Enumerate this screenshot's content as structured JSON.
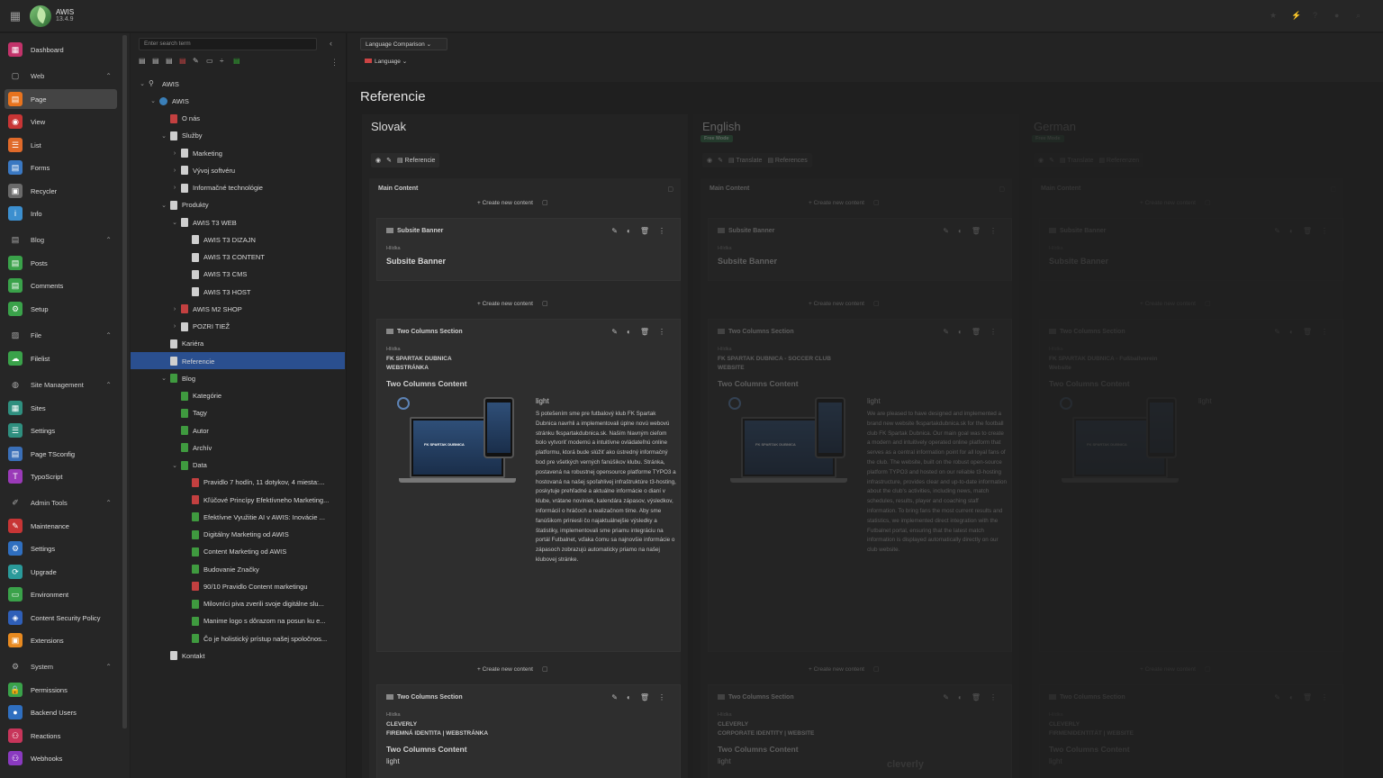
{
  "app": {
    "name": "AWIS",
    "version": "13.4.9"
  },
  "modules": [
    {
      "type": "item",
      "label": "Dashboard",
      "color": "#c2336a",
      "icon": "dashboard-icon",
      "glyph": "▦"
    },
    {
      "type": "header",
      "label": "Web",
      "icon": "web-icon",
      "glyph": "▢"
    },
    {
      "type": "item",
      "label": "Page",
      "color": "#e8731e",
      "icon": "page-icon",
      "glyph": "▤",
      "active": true
    },
    {
      "type": "item",
      "label": "View",
      "color": "#c73535",
      "icon": "view-icon",
      "glyph": "◉"
    },
    {
      "type": "item",
      "label": "List",
      "color": "#e06a2a",
      "icon": "list-icon",
      "glyph": "☰"
    },
    {
      "type": "item",
      "label": "Forms",
      "color": "#3a78c2",
      "icon": "forms-icon",
      "glyph": "▤"
    },
    {
      "type": "item",
      "label": "Recycler",
      "color": "#6a6a6a",
      "icon": "recycler-icon",
      "glyph": "▣"
    },
    {
      "type": "item",
      "label": "Info",
      "color": "#3c8fcf",
      "icon": "info-icon",
      "glyph": "i"
    },
    {
      "type": "header",
      "label": "Blog",
      "icon": "blog-icon",
      "glyph": "▤"
    },
    {
      "type": "item",
      "label": "Posts",
      "color": "#3aa24a",
      "icon": "posts-icon",
      "glyph": "▤"
    },
    {
      "type": "item",
      "label": "Comments",
      "color": "#3aa24a",
      "icon": "comments-icon",
      "glyph": "▤"
    },
    {
      "type": "item",
      "label": "Setup",
      "color": "#3aa24a",
      "icon": "setup-icon",
      "glyph": "⚙"
    },
    {
      "type": "header",
      "label": "File",
      "icon": "file-icon",
      "glyph": "▨"
    },
    {
      "type": "item",
      "label": "Filelist",
      "color": "#3aa24a",
      "icon": "filelist-icon",
      "glyph": "☁"
    },
    {
      "type": "header",
      "label": "Site Management",
      "icon": "site-management-icon",
      "glyph": "◍"
    },
    {
      "type": "item",
      "label": "Sites",
      "color": "#2f8f7f",
      "icon": "sites-icon",
      "glyph": "▦"
    },
    {
      "type": "item",
      "label": "Settings",
      "color": "#2f8f7f",
      "icon": "settings-icon",
      "glyph": "☰"
    },
    {
      "type": "item",
      "label": "Page TSconfig",
      "color": "#3a6fb8",
      "icon": "page-tsconfig-icon",
      "glyph": "▤"
    },
    {
      "type": "item",
      "label": "TypoScript",
      "color": "#9a3ab8",
      "icon": "typoscript-icon",
      "glyph": "T"
    },
    {
      "type": "header",
      "label": "Admin Tools",
      "icon": "admin-tools-icon",
      "glyph": "✐"
    },
    {
      "type": "item",
      "label": "Maintenance",
      "color": "#c73535",
      "icon": "maintenance-icon",
      "glyph": "✎"
    },
    {
      "type": "item",
      "label": "Settings",
      "color": "#2f6fc0",
      "icon": "admin-settings-icon",
      "glyph": "⚙"
    },
    {
      "type": "item",
      "label": "Upgrade",
      "color": "#2a9a9a",
      "icon": "upgrade-icon",
      "glyph": "⟳"
    },
    {
      "type": "item",
      "label": "Environment",
      "color": "#3aa24a",
      "icon": "environment-icon",
      "glyph": "▭"
    },
    {
      "type": "item",
      "label": "Content Security Policy",
      "color": "#2f5fb8",
      "icon": "csp-icon",
      "glyph": "◈"
    },
    {
      "type": "item",
      "label": "Extensions",
      "color": "#e88a20",
      "icon": "extensions-icon",
      "glyph": "▣"
    },
    {
      "type": "header",
      "label": "System",
      "icon": "system-icon",
      "glyph": "⚙"
    },
    {
      "type": "item",
      "label": "Permissions",
      "color": "#3aa24a",
      "icon": "permissions-icon",
      "glyph": "🔒"
    },
    {
      "type": "item",
      "label": "Backend Users",
      "color": "#2f6fc0",
      "icon": "backend-users-icon",
      "glyph": "●"
    },
    {
      "type": "item",
      "label": "Reactions",
      "color": "#c7355a",
      "icon": "reactions-icon",
      "glyph": "⚇"
    },
    {
      "type": "item",
      "label": "Webhooks",
      "color": "#8a3ac0",
      "icon": "webhooks-icon",
      "glyph": "⚇"
    }
  ],
  "tree": {
    "search_placeholder": "Enter search term",
    "nodes": [
      {
        "label": "AWIS",
        "depth": 0,
        "toggle": "⌄",
        "icon": "root"
      },
      {
        "label": "AWIS",
        "depth": 1,
        "toggle": "⌄",
        "icon": "globe"
      },
      {
        "label": "O nás",
        "depth": 2,
        "toggle": "",
        "icon": "red"
      },
      {
        "label": "Služby",
        "depth": 2,
        "toggle": "⌄",
        "icon": "page"
      },
      {
        "label": "Marketing",
        "depth": 3,
        "toggle": "›",
        "icon": "page"
      },
      {
        "label": "Vývoj softvéru",
        "depth": 3,
        "toggle": "›",
        "icon": "page"
      },
      {
        "label": "Informačné technológie",
        "depth": 3,
        "toggle": "›",
        "icon": "page"
      },
      {
        "label": "Produkty",
        "depth": 2,
        "toggle": "⌄",
        "icon": "page"
      },
      {
        "label": "AWIS T3 WEB",
        "depth": 3,
        "toggle": "⌄",
        "icon": "page"
      },
      {
        "label": "AWIS T3 DIZAJN",
        "depth": 4,
        "toggle": "",
        "icon": "page"
      },
      {
        "label": "AWIS T3 CONTENT",
        "depth": 4,
        "toggle": "",
        "icon": "page"
      },
      {
        "label": "AWIS T3 CMS",
        "depth": 4,
        "toggle": "",
        "icon": "page"
      },
      {
        "label": "AWIS T3 HOST",
        "depth": 4,
        "toggle": "",
        "icon": "page"
      },
      {
        "label": "AWIS M2 SHOP",
        "depth": 3,
        "toggle": "›",
        "icon": "red"
      },
      {
        "label": "POZRI TIEŽ",
        "depth": 3,
        "toggle": "›",
        "icon": "page"
      },
      {
        "label": "Kariéra",
        "depth": 2,
        "toggle": "",
        "icon": "page"
      },
      {
        "label": "Referencie",
        "depth": 2,
        "toggle": "",
        "icon": "page",
        "selected": true
      },
      {
        "label": "Blog",
        "depth": 2,
        "toggle": "⌄",
        "icon": "green"
      },
      {
        "label": "Kategórie",
        "depth": 3,
        "toggle": "",
        "icon": "green"
      },
      {
        "label": "Tagy",
        "depth": 3,
        "toggle": "",
        "icon": "green"
      },
      {
        "label": "Autor",
        "depth": 3,
        "toggle": "",
        "icon": "green"
      },
      {
        "label": "Archív",
        "depth": 3,
        "toggle": "",
        "icon": "green"
      },
      {
        "label": "Data",
        "depth": 3,
        "toggle": "⌄",
        "icon": "green"
      },
      {
        "label": "Pravidlo 7 hodín, 11 dotykov, 4 miesta:...",
        "depth": 4,
        "toggle": "",
        "icon": "red"
      },
      {
        "label": "Kľúčové Princípy Efektívneho Marketing...",
        "depth": 4,
        "toggle": "",
        "icon": "red"
      },
      {
        "label": "Efektívne Využitie AI v AWIS: Inovácie ...",
        "depth": 4,
        "toggle": "",
        "icon": "green"
      },
      {
        "label": "Digitálny Marketing od AWIS",
        "depth": 4,
        "toggle": "",
        "icon": "green"
      },
      {
        "label": "Content Marketing od AWIS",
        "depth": 4,
        "toggle": "",
        "icon": "green"
      },
      {
        "label": "Budovanie Značky",
        "depth": 4,
        "toggle": "",
        "icon": "green"
      },
      {
        "label": "90/10 Pravidlo Content marketingu",
        "depth": 4,
        "toggle": "",
        "icon": "red"
      },
      {
        "label": "Milovníci piva zverili svoje digitálne slu...",
        "depth": 4,
        "toggle": "",
        "icon": "green"
      },
      {
        "label": "Manime logo s dôrazom na posun ku e...",
        "depth": 4,
        "toggle": "",
        "icon": "green"
      },
      {
        "label": "Čo je holistický prístup našej spoločnos...",
        "depth": 4,
        "toggle": "",
        "icon": "green"
      },
      {
        "label": "Kontakt",
        "depth": 2,
        "toggle": "",
        "icon": "page"
      }
    ]
  },
  "docheader": {
    "view_select": "Language Comparison",
    "language_select": "Language"
  },
  "page_title": "Referencie",
  "labels": {
    "main_content": "Main Content",
    "create_new": "+ Create new content",
    "translate": "Translate",
    "free_mode": "Free Mode",
    "header_small": "Hlídka",
    "two_col_content": "Two Columns Content",
    "light": "light"
  },
  "columns": [
    {
      "lang": "Slovak",
      "badge": "",
      "page": "Referencie",
      "ce1": {
        "type": "Subsite Banner",
        "title": "Subsite Banner"
      },
      "ce2": {
        "type": "Two Columns Section",
        "sub1": "FK SPARTAK DUBNICA",
        "sub2": "WEBSTRÁNKA",
        "img_caption": "FK SPARTAK DUBNICA",
        "body": "S potešením sme pre futbalový klub FK Spartak Dubnica navrhli a implementovali úplne novú webovú stránku fkspartakdubnica.sk. Naším hlavným cieľom bolo vytvoriť modernú a intuitívne ovládateľnú online platformu, ktorá bude slúžiť ako ústredný informačný bod pre všetkých verných fanúšikov klubu. Stránka, postavená na robustnej opensource platforme TYPO3 a hostovaná na našej spoľahlivej infraštruktúre t3-hosting, poskytuje prehľadné a aktuálne informácie o dianí v klube, vrátane noviniek, kalendára zápasov, výsledkov, informácií o hráčoch a realizačnom tíme. Aby sme fanúšikom priniesli čo najaktuálnejšie výsledky a štatistiky, implementovali sme priamu integráciu na portál Futbalnet, vďaka čomu sa najnovšie informácie o zápasoch zobrazujú automaticky priamo na našej klubovej stránke."
      },
      "ce3": {
        "type": "Two Columns Section",
        "sub1": "CLEVERLY",
        "sub2": "FIREMNÁ IDENTITA | WEBSTRÁNKA"
      }
    },
    {
      "lang": "English",
      "badge": "Free Mode",
      "page": "References",
      "ce1": {
        "type": "Subsite Banner",
        "title": "Subsite Banner"
      },
      "ce2": {
        "type": "Two Columns Section",
        "sub1": "FK SPARTAK DUBNICA - SOCCER CLUB",
        "sub2": "WEBSITE",
        "img_caption": "FK SPARTAK DUBNICA",
        "body": "We are pleased to have designed and implemented a brand new website fkspartakdubnica.sk for the football club FK Spartak Dubnica. Our main goal was to create a modern and intuitively operated online platform that serves as a central information point for all loyal fans of the club. The website, built on the robust open-source platform TYPO3 and hosted on our reliable t3-hosting infrastructure, provides clear and up-to-date information about the club's activities, including news, match schedules, results, player and coaching staff information. To bring fans the most current results and statistics, we implemented direct integration with the Futbalnet portal, ensuring that the latest match information is displayed automatically directly on our club website."
      },
      "ce3": {
        "type": "Two Columns Section",
        "sub1": "CLEVERLY",
        "sub2": "CORPORATE IDENTITY | WEBSITE",
        "extra": "cleverly"
      }
    },
    {
      "lang": "German",
      "badge": "Free Mode",
      "page": "Referenzen",
      "ce1": {
        "type": "Subsite Banner",
        "title": "Subsite Banner"
      },
      "ce2": {
        "type": "Two Columns Section",
        "sub1": "FK SPARTAK DUBNICA - Fußballverein",
        "sub2": "Website",
        "img_caption": "FK SPARTAK DUBNICA",
        "body": ""
      },
      "ce3": {
        "type": "Two Columns Section",
        "sub1": "CLEVERLY",
        "sub2": "FIRMENIDENTITÄT | WEBSITE"
      }
    }
  ]
}
